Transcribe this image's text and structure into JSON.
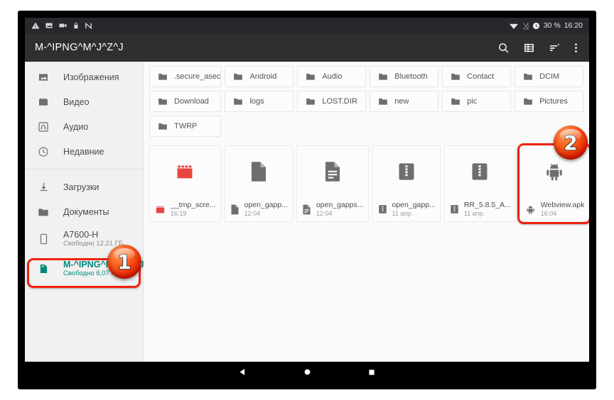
{
  "status_bar": {
    "left_icons": [
      "warning-triangle-icon",
      "image-icon",
      "video-icon",
      "lock-icon",
      "nfc-n-icon"
    ],
    "battery_percent": "30 %",
    "time": "16:20",
    "wifi_icon": "wifi-icon",
    "signal_icon": "signal-off-icon",
    "clock_icon": "alarm-clock-icon"
  },
  "app_bar": {
    "title": "M-^IPNG^M^J^Z^J",
    "actions": [
      {
        "name": "search-icon",
        "label": "Поиск"
      },
      {
        "name": "view-list-icon",
        "label": "Вид списка"
      },
      {
        "name": "sort-icon",
        "label": "Сортировка"
      },
      {
        "name": "overflow-menu-icon",
        "label": "Ещё"
      }
    ]
  },
  "sidebar": {
    "items": [
      {
        "label": "Изображения",
        "icon": "image-icon"
      },
      {
        "label": "Видео",
        "icon": "video-icon"
      },
      {
        "label": "Аудио",
        "icon": "audio-icon"
      },
      {
        "label": "Недавние",
        "icon": "clock-icon"
      }
    ],
    "storage": [
      {
        "label": "Загрузки",
        "icon": "download-icon",
        "sub": ""
      },
      {
        "label": "Документы",
        "icon": "folder-icon",
        "sub": ""
      },
      {
        "label": "A7600-H",
        "icon": "phone-icon",
        "sub": "Свободно 12,21 ГБ"
      },
      {
        "label": "M-^IPNG^M^J^Z^J",
        "icon": "sdcard-icon",
        "sub": "Свободно 6,07 ГБ",
        "selected": true
      }
    ]
  },
  "folders": [
    {
      "name": ".secure_asec"
    },
    {
      "name": "Android"
    },
    {
      "name": "Audio"
    },
    {
      "name": "Bluetooth"
    },
    {
      "name": "Contact"
    },
    {
      "name": "DCIM"
    },
    {
      "name": "Download"
    },
    {
      "name": "logs"
    },
    {
      "name": "LOST.DIR"
    },
    {
      "name": "new"
    },
    {
      "name": "pic"
    },
    {
      "name": "Pictures"
    },
    {
      "name": "TWRP"
    }
  ],
  "files": [
    {
      "name": "__tmp_scre...",
      "date": "16:19",
      "icon": "movie-clapper-icon"
    },
    {
      "name": "open_gapp...",
      "date": "12:04",
      "icon": "document-icon"
    },
    {
      "name": "open_gapps...",
      "date": "12:04",
      "icon": "text-document-icon"
    },
    {
      "name": "open_gapp...",
      "date": "11 апр.",
      "icon": "archive-zip-icon"
    },
    {
      "name": "RR_5.8.5_A...",
      "date": "11 апр.",
      "icon": "archive-zip-icon"
    },
    {
      "name": "Webview.apk",
      "date": "16:04",
      "icon": "android-apk-icon",
      "highlighted": true
    }
  ],
  "nav_bar": {
    "back": "back-triangle-icon",
    "home": "home-circle-icon",
    "recents": "recents-square-icon"
  },
  "annotations": {
    "badge_1": "1",
    "badge_2": "2",
    "highlight_color": "#ee2211"
  },
  "colors": {
    "accent_teal": "#00897b",
    "app_bar": "#2d2f31",
    "status_bar": "#26282b",
    "sidebar_bg": "#f1f1f1",
    "content_bg": "#fafafa"
  }
}
